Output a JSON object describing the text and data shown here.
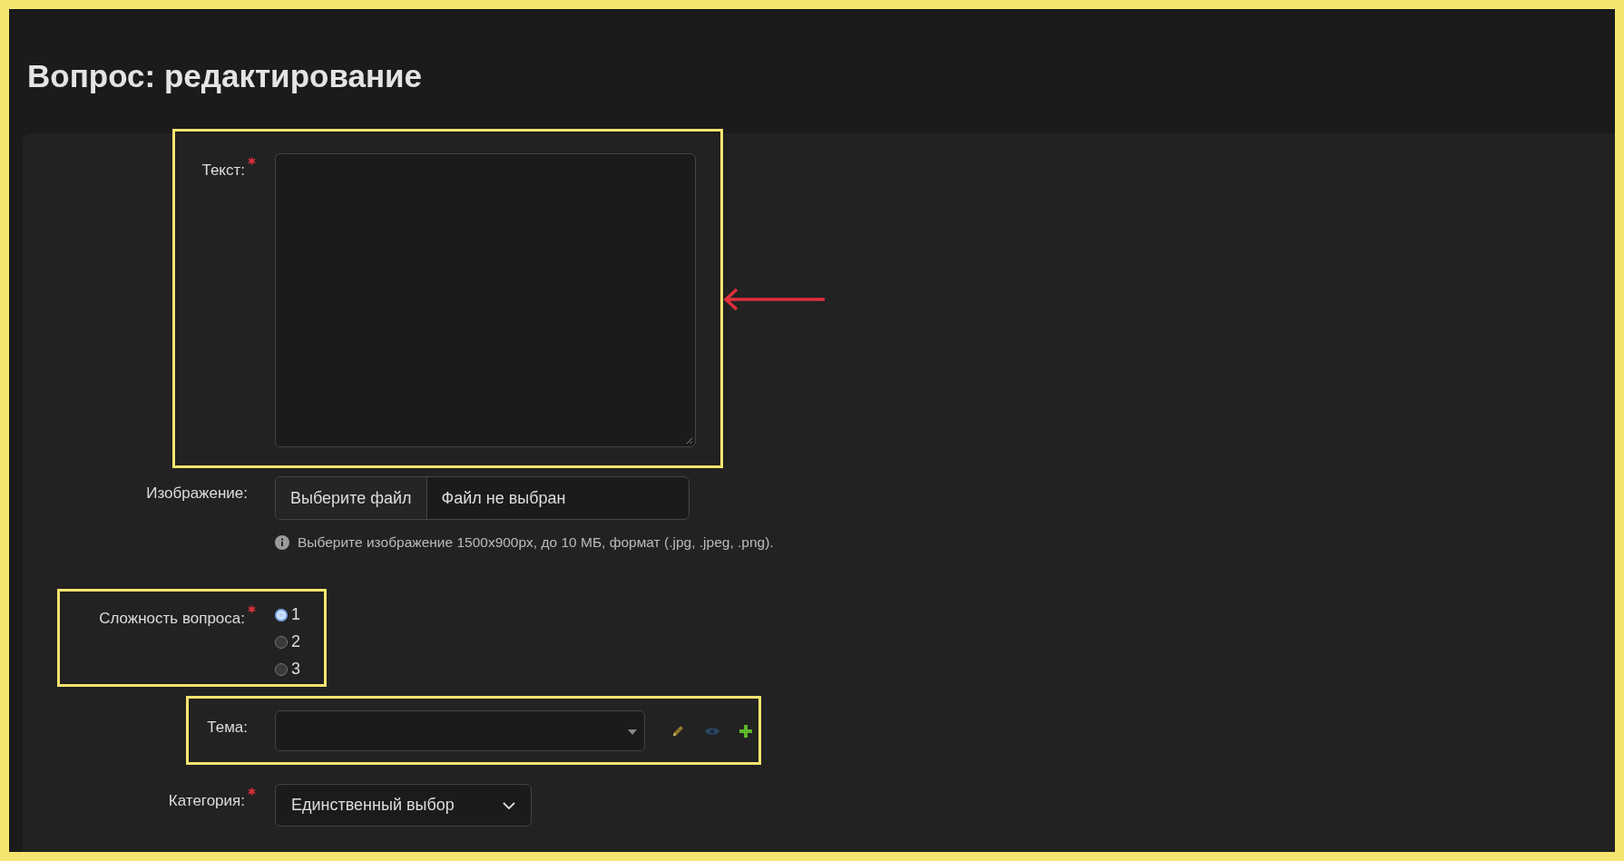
{
  "page": {
    "title": "Вопрос: редактирование"
  },
  "fields": [
    {
      "kind": "textarea",
      "label": "Текст:",
      "required": true,
      "highlighted": true,
      "arrow": true
    },
    {
      "kind": "file",
      "label": "Изображение:",
      "required": false,
      "highlighted": false,
      "arrow": false,
      "button": "Выберите файл",
      "status": "Файл не выбран",
      "hint": "Выберите изображение 1500x900px, до 10 МБ, формат (.jpg, .jpeg, .png)."
    },
    {
      "kind": "radio",
      "label": "Сложность вопроса:",
      "required": true,
      "highlighted": true,
      "arrow": false,
      "options": [
        {
          "label": "1",
          "selected": true
        },
        {
          "label": "2",
          "selected": false
        },
        {
          "label": "3",
          "selected": false
        }
      ]
    },
    {
      "kind": "select",
      "label": "Тема:",
      "required": false,
      "highlighted": true,
      "arrow": false
    },
    {
      "kind": "dropdown",
      "label": "Категория:",
      "required": true,
      "highlighted": false,
      "arrow": false,
      "value": "Единственный выбор"
    }
  ]
}
